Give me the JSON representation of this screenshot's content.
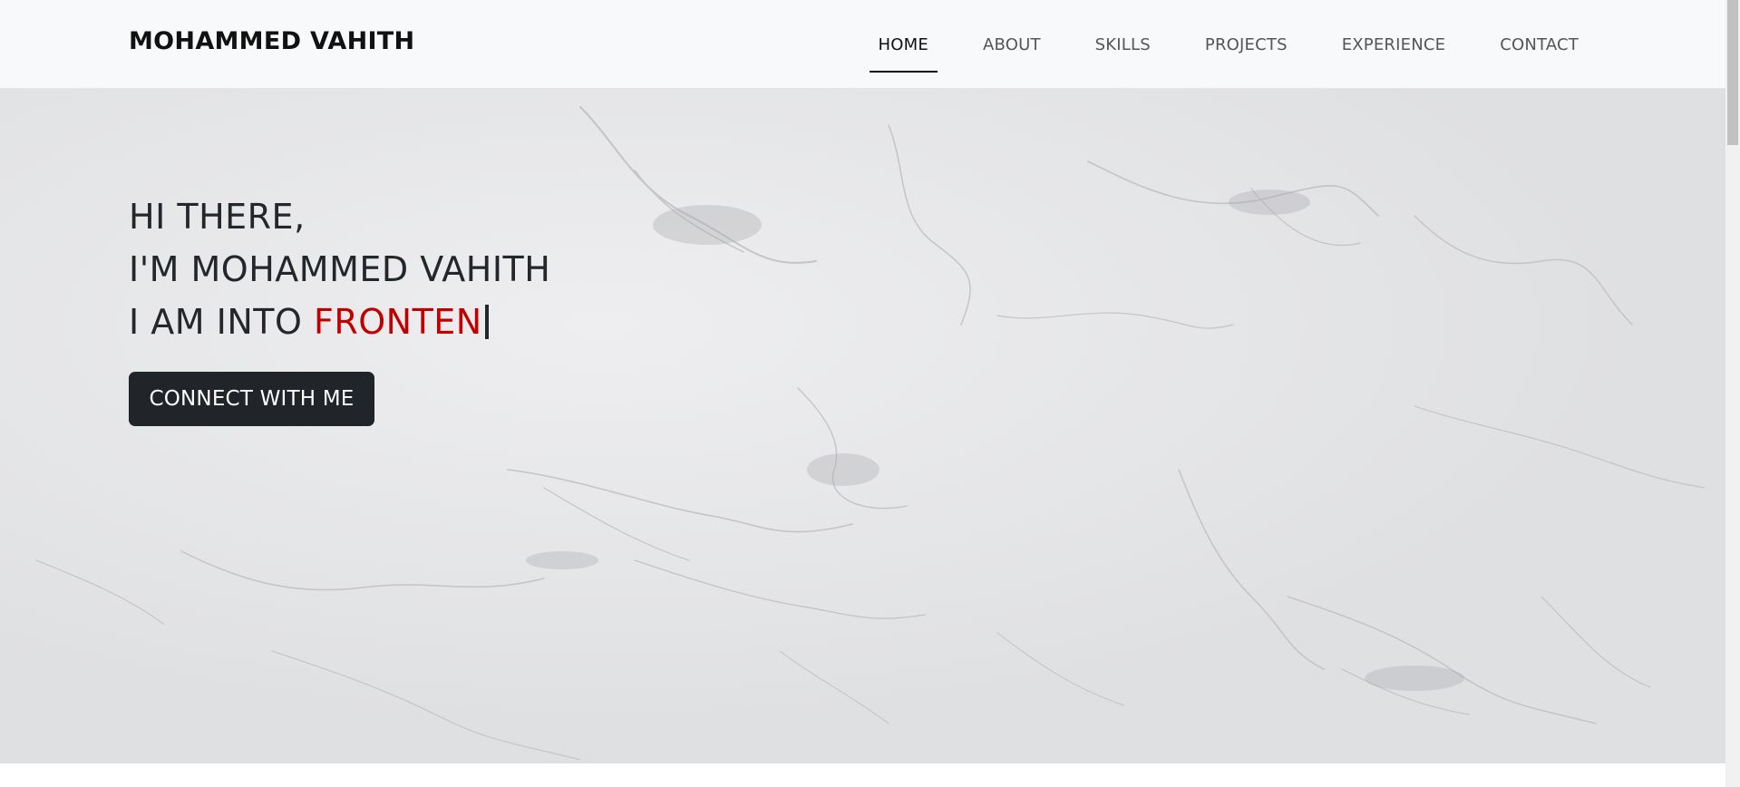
{
  "navbar": {
    "brand": "MOHAMMED VAHITH",
    "items": [
      {
        "label": "HOME",
        "active": true
      },
      {
        "label": "ABOUT",
        "active": false
      },
      {
        "label": "SKILLS",
        "active": false
      },
      {
        "label": "PROJECTS",
        "active": false
      },
      {
        "label": "EXPERIENCE",
        "active": false
      },
      {
        "label": "CONTACT",
        "active": false
      }
    ]
  },
  "hero": {
    "line1": "HI THERE,",
    "line2": "I'M MOHAMMED VAHITH",
    "line3_prefix": "I AM INTO ",
    "line3_typed": "FRONTEN",
    "button_label": "CONNECT WITH ME"
  },
  "colors": {
    "navbar_bg": "#f8f9fa",
    "accent_red": "#c00000",
    "button_bg": "#212529",
    "hero_bg": "#e6e7e9"
  }
}
